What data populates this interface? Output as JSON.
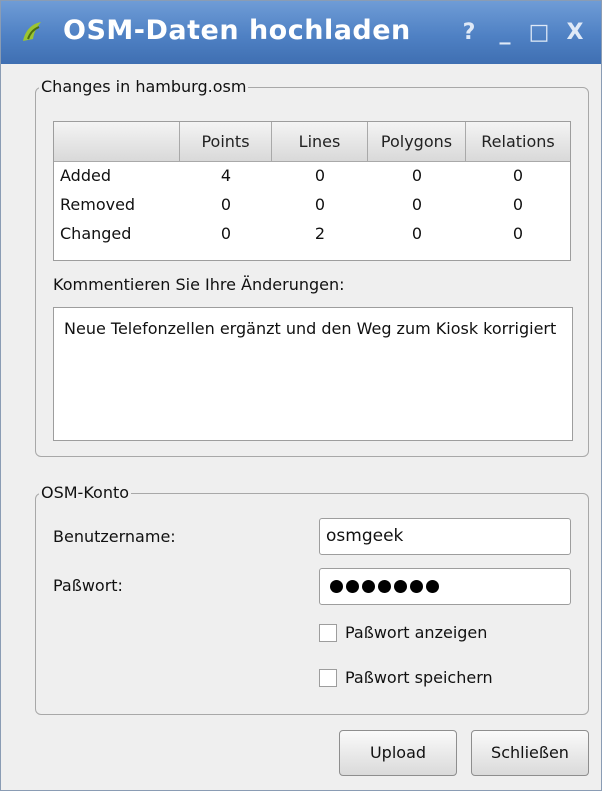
{
  "window": {
    "title": "OSM-Daten hochladen",
    "buttons": {
      "help": "?",
      "minimize": "_",
      "maximize": "□",
      "close": "X"
    }
  },
  "changes": {
    "legend": "Changes in hamburg.osm",
    "columns": [
      "",
      "Points",
      "Lines",
      "Polygons",
      "Relations"
    ],
    "rows": [
      {
        "label": "Added",
        "values": [
          "4",
          "0",
          "0",
          "0"
        ]
      },
      {
        "label": "Removed",
        "values": [
          "0",
          "0",
          "0",
          "0"
        ]
      },
      {
        "label": "Changed",
        "values": [
          "0",
          "2",
          "0",
          "0"
        ]
      }
    ],
    "comment_label": "Kommentieren Sie Ihre Änderungen:",
    "comment_value": "Neue Telefonzellen ergänzt und den Weg zum Kiosk korrigiert"
  },
  "account": {
    "legend": "OSM-Konto",
    "username_label": "Benutzername:",
    "username_value": "osmgeek",
    "password_label": "Paßwort:",
    "password_mask_count": 7,
    "show_password_label": "Paßwort anzeigen",
    "save_password_label": "Paßwort speichern",
    "show_password_checked": false,
    "save_password_checked": false
  },
  "footer": {
    "upload_label": "Upload",
    "close_label": "Schließen"
  },
  "icons": {
    "app": "qgis-logo-icon"
  },
  "colors": {
    "titlebar": "#4f81c4",
    "app_icon": "#9bc531"
  }
}
